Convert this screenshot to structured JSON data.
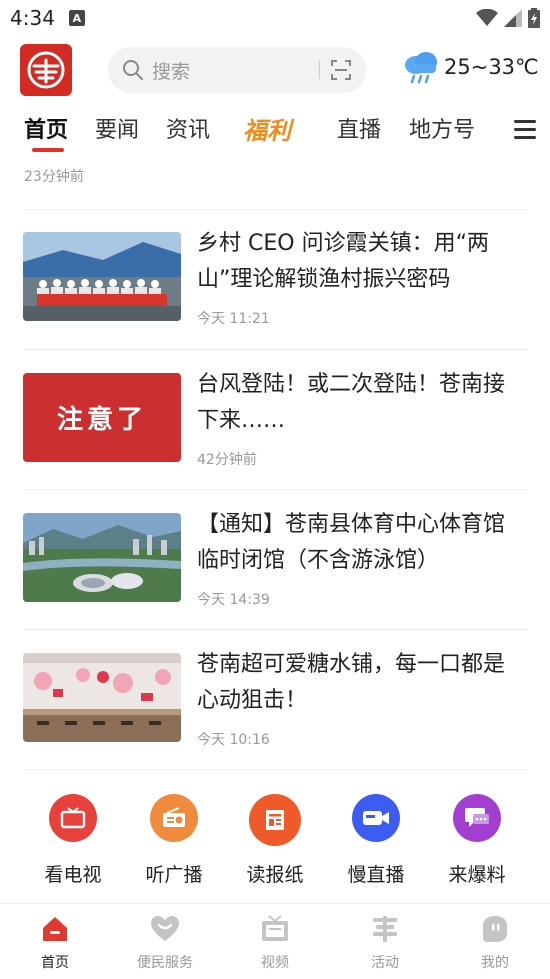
{
  "status_bar": {
    "time": "4:34",
    "a_badge": "A"
  },
  "header": {
    "search_placeholder": "搜索",
    "weather": {
      "temperature": "25~33℃",
      "icon": "cloud-rain-icon"
    }
  },
  "tabs": [
    {
      "label": "首页",
      "active": true
    },
    {
      "label": "要闻"
    },
    {
      "label": "资讯"
    },
    {
      "label": "福利"
    },
    {
      "label": "直播"
    },
    {
      "label": "地方号"
    }
  ],
  "previous_item_time": "23分钟前",
  "news": [
    {
      "title": "乡村 CEO 问诊霞关镇：用“两山”理论解锁渔村振兴密码",
      "time": "今天 11:21"
    },
    {
      "title": "台风登陆！或二次登陆！苍南接下来……",
      "time": "42分钟前",
      "thumb_text": "注意了"
    },
    {
      "title": "【通知】苍南县体育中心体育馆临时闭馆（不含游泳馆）",
      "time": "今天 14:39"
    },
    {
      "title": "苍南超可爱糖水铺，每一口都是心动狙击！",
      "time": "今天 10:16"
    }
  ],
  "quick_entries": [
    {
      "label": "看电视",
      "color": "#e8403a",
      "icon": "tv-icon"
    },
    {
      "label": "听广播",
      "color": "#f08a3c",
      "icon": "radio-icon"
    },
    {
      "label": "读报纸",
      "color": "#ef5a2a",
      "icon": "newspaper-icon"
    },
    {
      "label": "慢直播",
      "color": "#3d5df2",
      "icon": "video-camera-icon"
    },
    {
      "label": "来爆料",
      "color": "#a23fd0",
      "icon": "message-icon"
    }
  ],
  "bottom_nav": [
    {
      "label": "首页",
      "active": true,
      "icon": "home-icon"
    },
    {
      "label": "便民服务",
      "icon": "heart-icon"
    },
    {
      "label": "视频",
      "icon": "video-icon"
    },
    {
      "label": "活动",
      "icon": "activity-icon"
    },
    {
      "label": "我的",
      "icon": "profile-icon"
    }
  ],
  "colors": {
    "accent": "#e2312a",
    "fuli": "#f08c1e"
  }
}
